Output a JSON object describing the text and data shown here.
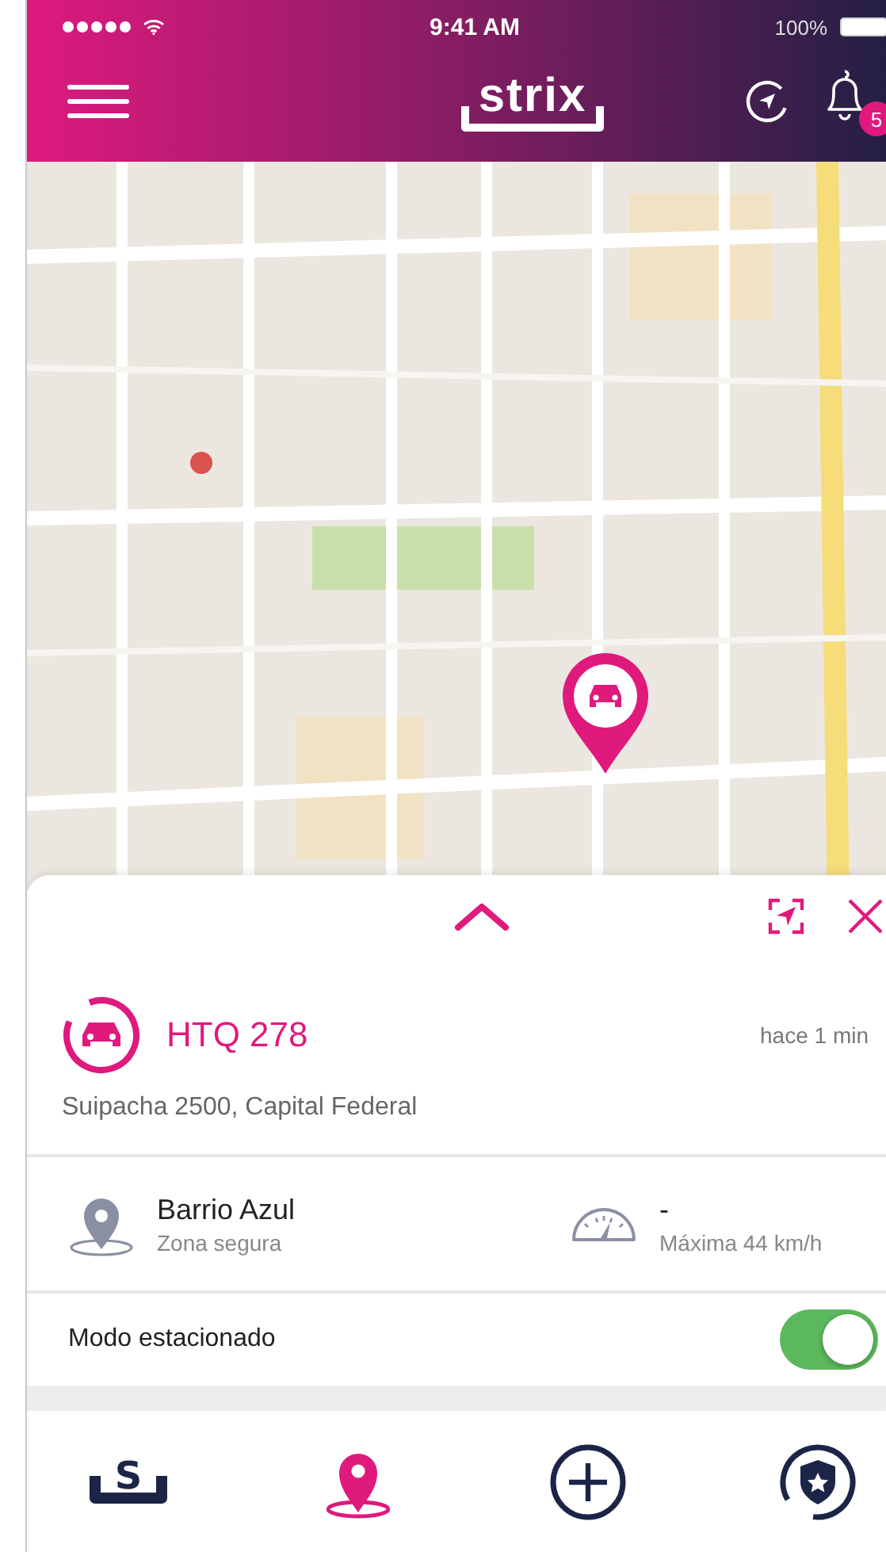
{
  "status_bar": {
    "time": "9:41 AM",
    "battery": "100%"
  },
  "header": {
    "logo": "strix",
    "notifications": "5"
  },
  "panel": {
    "vehicle": {
      "plate": "HTQ 278",
      "updated": "hace 1 min",
      "address": "Suipacha 2500, Capital Federal"
    },
    "zone": {
      "name": "Barrio Azul",
      "caption": "Zona segura"
    },
    "speed": {
      "value": "-",
      "caption": "Máxima 44 km/h"
    },
    "parking_mode": {
      "label": "Modo estacionado",
      "on": true
    }
  },
  "tabs": [
    {
      "kind": "brand",
      "glyph": "S",
      "selected": false
    },
    {
      "kind": "location",
      "selected": true
    },
    {
      "kind": "add",
      "selected": false
    },
    {
      "kind": "shield",
      "selected": false
    }
  ]
}
